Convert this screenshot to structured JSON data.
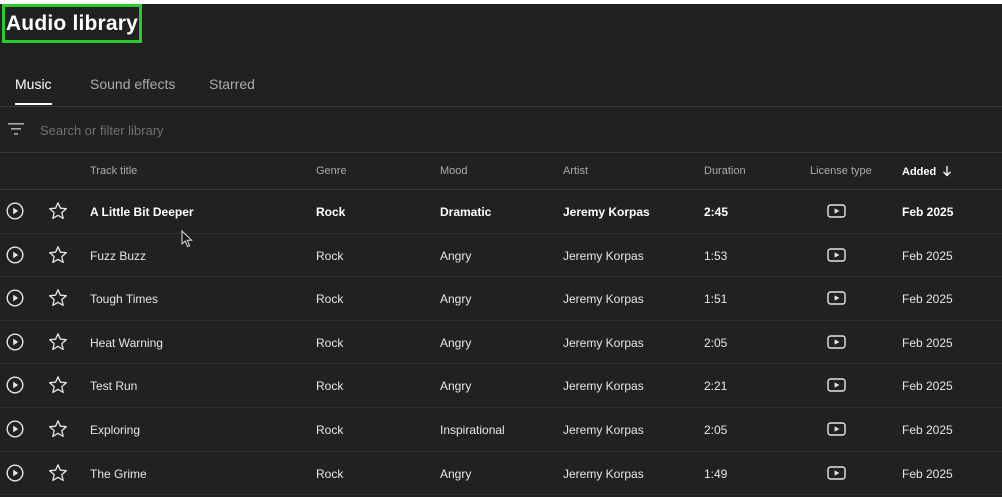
{
  "page": {
    "title": "Audio library"
  },
  "tabs": [
    {
      "label": "Music",
      "active": true
    },
    {
      "label": "Sound effects",
      "active": false
    },
    {
      "label": "Starred",
      "active": false
    }
  ],
  "search": {
    "placeholder": "Search or filter library",
    "value": ""
  },
  "columns": {
    "track_title": "Track title",
    "genre": "Genre",
    "mood": "Mood",
    "artist": "Artist",
    "duration": "Duration",
    "license_type": "License type",
    "added": "Added"
  },
  "sort": {
    "column": "added",
    "direction": "descending"
  },
  "tracks": [
    {
      "title": "A Little Bit Deeper",
      "genre": "Rock",
      "mood": "Dramatic",
      "artist": "Jeremy Korpas",
      "duration": "2:45",
      "license_icon": "youtube-license-icon",
      "added": "Feb 2025"
    },
    {
      "title": "Fuzz Buzz",
      "genre": "Rock",
      "mood": "Angry",
      "artist": "Jeremy Korpas",
      "duration": "1:53",
      "license_icon": "youtube-license-icon",
      "added": "Feb 2025"
    },
    {
      "title": "Tough Times",
      "genre": "Rock",
      "mood": "Angry",
      "artist": "Jeremy Korpas",
      "duration": "1:51",
      "license_icon": "youtube-license-icon",
      "added": "Feb 2025"
    },
    {
      "title": "Heat Warning",
      "genre": "Rock",
      "mood": "Angry",
      "artist": "Jeremy Korpas",
      "duration": "2:05",
      "license_icon": "youtube-license-icon",
      "added": "Feb 2025"
    },
    {
      "title": "Test Run",
      "genre": "Rock",
      "mood": "Angry",
      "artist": "Jeremy Korpas",
      "duration": "2:21",
      "license_icon": "youtube-license-icon",
      "added": "Feb 2025"
    },
    {
      "title": "Exploring",
      "genre": "Rock",
      "mood": "Inspirational",
      "artist": "Jeremy Korpas",
      "duration": "2:05",
      "license_icon": "youtube-license-icon",
      "added": "Feb 2025"
    },
    {
      "title": "The Grime",
      "genre": "Rock",
      "mood": "Angry",
      "artist": "Jeremy Korpas",
      "duration": "1:49",
      "license_icon": "youtube-license-icon",
      "added": "Feb 2025"
    }
  ],
  "highlighted_row": 0,
  "colors": {
    "background": "#212121",
    "title_highlight_border": "#2bc92b",
    "text_primary": "#ffffff",
    "text_secondary": "#aaaaaa",
    "divider": "#3a3a3a"
  },
  "icons": {
    "filter": "filter-icon",
    "play": "play-circle-icon",
    "star": "star-outline-icon",
    "sort": "arrow-down-icon",
    "cursor": "mouse-pointer-icon"
  }
}
